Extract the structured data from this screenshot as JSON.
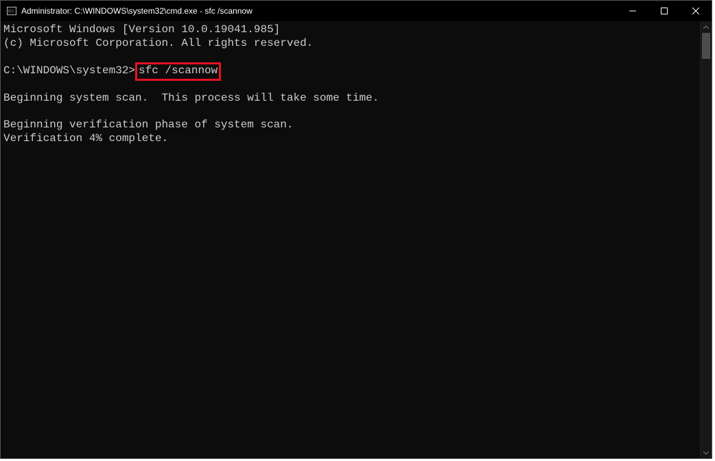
{
  "window": {
    "title": "Administrator: C:\\WINDOWS\\system32\\cmd.exe -  sfc  /scannow"
  },
  "terminal": {
    "header_line1": "Microsoft Windows [Version 10.0.19041.985]",
    "header_line2": "(c) Microsoft Corporation. All rights reserved.",
    "prompt": "C:\\WINDOWS\\system32>",
    "command": "sfc /scannow",
    "scan_line": "Beginning system scan.  This process will take some time.",
    "verify_line": "Beginning verification phase of system scan.",
    "progress_line": "Verification 4% complete."
  },
  "highlight_color": "#e81123"
}
